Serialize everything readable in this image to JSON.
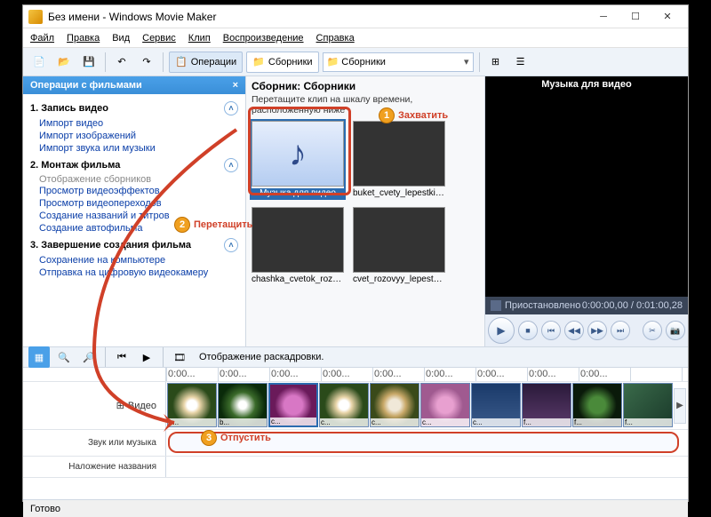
{
  "window": {
    "title": "Без имени - Windows Movie Maker"
  },
  "menu": {
    "file": "Файл",
    "edit": "Правка",
    "view": "Вид",
    "service": "Сервис",
    "clip": "Клип",
    "play": "Воспроизведение",
    "help": "Справка"
  },
  "toolbar": {
    "operations": "Операции",
    "collections": "Сборники",
    "combo": "Сборники"
  },
  "tasks": {
    "header": "Операции с фильмами",
    "sec1": "1. Запись видео",
    "s1": {
      "a": "Импорт видео",
      "b": "Импорт изображений",
      "c": "Импорт звука или музыки"
    },
    "sec2": "2. Монтаж фильма",
    "s2": {
      "a": "Отображение сборников",
      "b": "Просмотр видеоэффектов",
      "c": "Просмотр видеопереходов",
      "d": "Создание названий и титров",
      "e": "Создание автофильма"
    },
    "sec3": "3. Завершение создания фильма",
    "s3": {
      "a": "Сохранение на компьютере",
      "b": "Отправка на цифровую видеокамеру"
    }
  },
  "center": {
    "title": "Сборник: Сборники",
    "sub": "Перетащите клип на шкалу времени, расположенную ниже",
    "thumbs": {
      "music": "Музыка для видео",
      "t2": "buket_cvety_lepestki_be...",
      "t3": "chashka_cvetok_roza_8...",
      "t4": "cvet_rozovyy_lepestki_r..."
    }
  },
  "preview": {
    "title": "Музыка для видео",
    "status": "Приостановлено",
    "time": "0:00:00,00 / 0:01:00,28"
  },
  "timeline": {
    "toolbar_label": "Отображение раскадровки.",
    "ruler": [
      "0:00",
      "0:00",
      "0:00",
      "0:00",
      "0:00",
      "0:00",
      "0:00",
      "0:00",
      "0:00"
    ],
    "rows": {
      "video": "Видео",
      "audio": "Звук или музыка",
      "title": "Наложение названия"
    },
    "clips": [
      "b...",
      "b...",
      "c...",
      "c...",
      "c...",
      "c...",
      "c...",
      "f...",
      "f...",
      "f..."
    ]
  },
  "callouts": {
    "c1": "Захватить",
    "c2": "Перетащить",
    "c3": "Отпустить"
  },
  "status": "Готово"
}
